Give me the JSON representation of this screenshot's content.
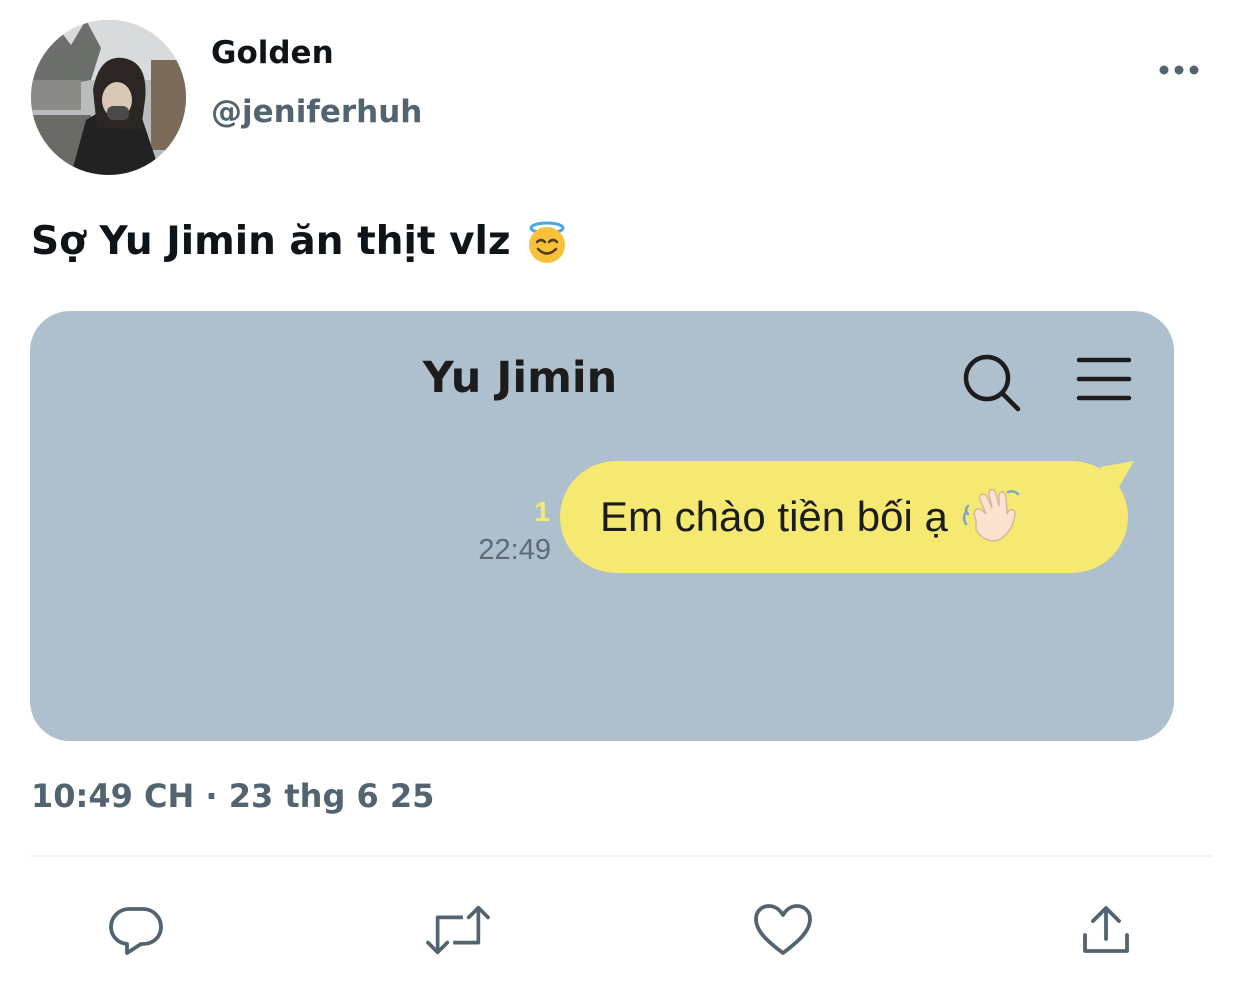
{
  "author": {
    "display_name": "Golden",
    "handle": "@jeniferhuh",
    "avatar_icon": "profile-photo"
  },
  "more_icon": "more-horizontal-icon",
  "tweet": {
    "text": "Sợ Yu Jimin ăn thịt vlz",
    "emoji": "smiling-face-with-halo-emoji"
  },
  "media": {
    "chat_title": "Yu Jimin",
    "header_icons": [
      "search-icon",
      "menu-icon"
    ],
    "message": {
      "text": "Em chào tiền bối ạ",
      "emoji": "waving-hand-emoji",
      "unread_count": "1",
      "time": "22:49"
    },
    "colors": {
      "background": "#aebfcd",
      "bubble": "#f5e972"
    }
  },
  "timestamp": "10:49 CH · 23 thg 6 25",
  "actions": {
    "icons": [
      "reply-icon",
      "retweet-icon",
      "like-icon",
      "share-icon"
    ]
  },
  "colors": {
    "text": "#0f1419",
    "secondary": "#536471"
  }
}
